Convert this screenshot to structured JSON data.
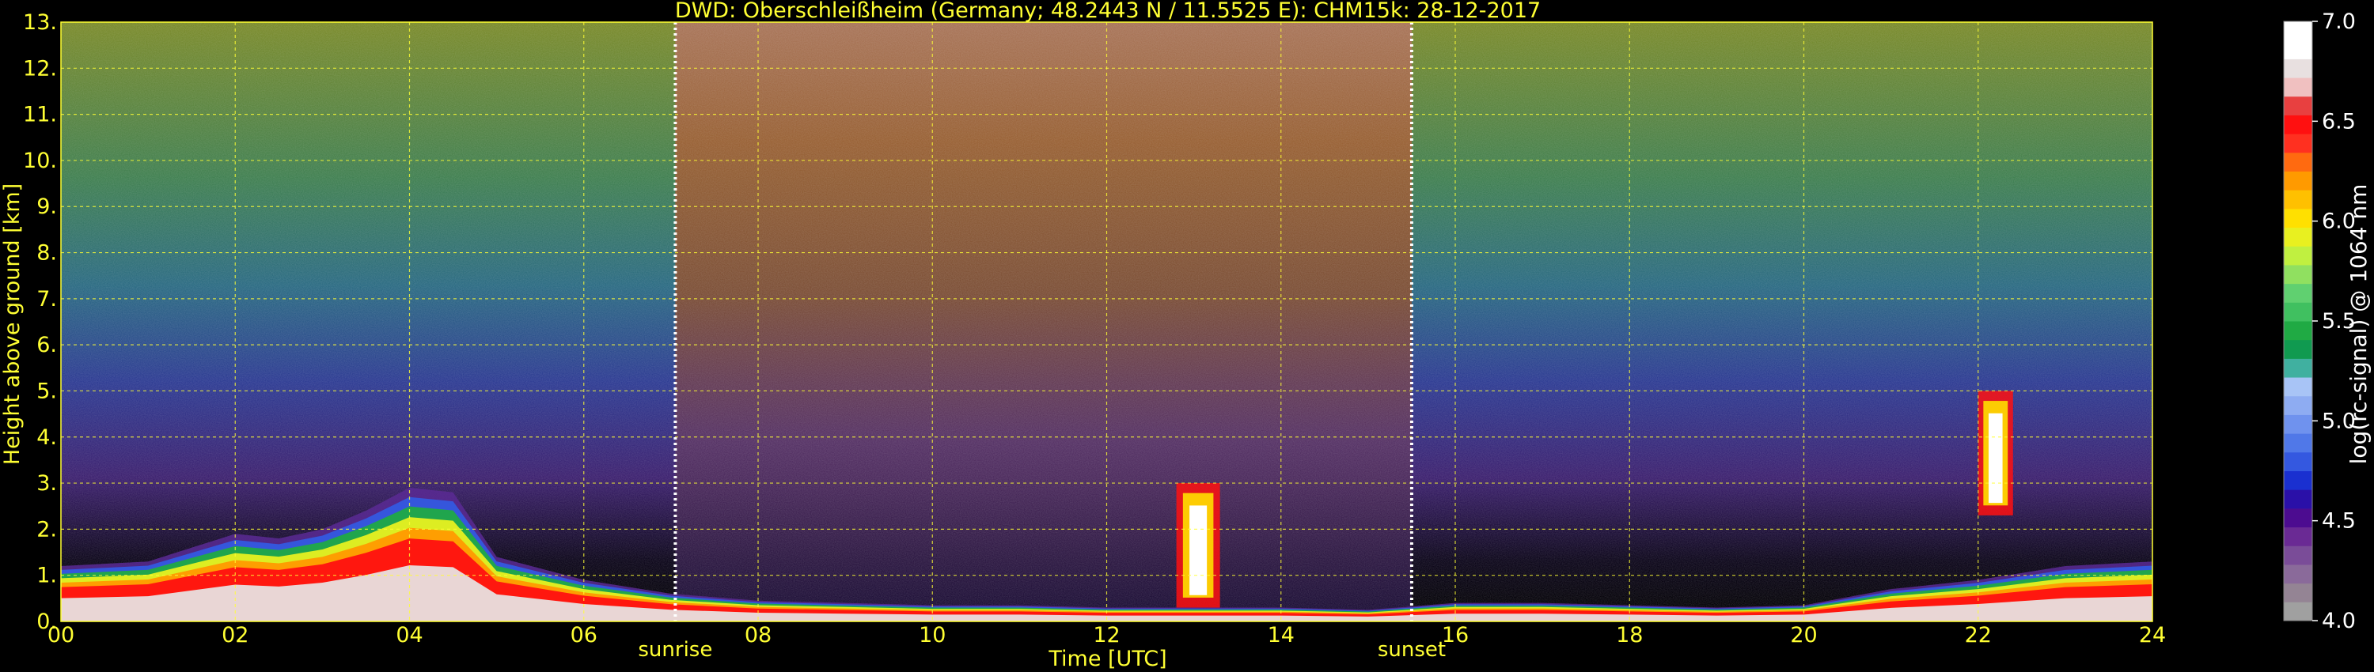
{
  "chart_data": {
    "type": "heatmap",
    "title": "DWD: Oberschleißheim (Germany; 48.2443 N / 11.5525 E):    CHM15k: 28-12-2017",
    "xlabel": "Time [UTC]",
    "ylabel": "Height above ground [km]",
    "xlim": [
      0,
      24
    ],
    "ylim": [
      0,
      13
    ],
    "x_ticks": [
      "00",
      "02",
      "04",
      "06",
      "08",
      "10",
      "12",
      "14",
      "16",
      "18",
      "20",
      "22",
      "24"
    ],
    "y_ticks": [
      "0.",
      "1.",
      "2.",
      "3.",
      "4.",
      "5.",
      "6.",
      "7.",
      "8.",
      "9.",
      "10.",
      "11.",
      "12.",
      "13."
    ],
    "grid": true,
    "markers": [
      {
        "label": "sunrise",
        "time": 7.05
      },
      {
        "label": "sunset",
        "time": 15.5
      }
    ],
    "colorbar": {
      "label": "log(rc-signal) @ 1064 nm",
      "range": [
        4.0,
        7.0
      ],
      "ticks": [
        "4.0",
        "4.5",
        "5.0",
        "5.5",
        "6.0",
        "6.5",
        "7.0"
      ],
      "colors": [
        "#a0a0a0",
        "#948494",
        "#8a6a9a",
        "#7a4c98",
        "#6a2a94",
        "#4c0c90",
        "#2a10a8",
        "#1a30d0",
        "#3458e0",
        "#5078e8",
        "#6f92ee",
        "#8eacf2",
        "#a8c4f6",
        "#40b0a0",
        "#109a50",
        "#20aa44",
        "#40c060",
        "#60d070",
        "#90e060",
        "#c0f040",
        "#e8f020",
        "#ffe000",
        "#ffc000",
        "#ff9a00",
        "#ff6a10",
        "#ff3020",
        "#ff1010",
        "#e84040",
        "#f0c0c0",
        "#e8e0e0",
        "#ffffff",
        "#ffffff"
      ]
    },
    "features": [
      {
        "type": "boundary_layer_aerosol",
        "x": [
          0,
          1,
          2,
          2.5,
          3,
          3.5,
          4,
          4.5,
          5,
          6,
          7,
          8,
          9,
          10,
          11,
          12,
          13,
          14,
          15,
          16,
          17,
          18,
          19,
          20,
          21,
          22,
          23,
          24
        ],
        "top_km": [
          1.2,
          1.3,
          1.9,
          1.8,
          2.0,
          2.4,
          2.9,
          2.8,
          1.4,
          0.9,
          0.6,
          0.45,
          0.4,
          0.35,
          0.35,
          0.3,
          0.3,
          0.3,
          0.25,
          0.4,
          0.4,
          0.35,
          0.3,
          0.35,
          0.7,
          0.9,
          1.2,
          1.3
        ]
      },
      {
        "type": "cloud",
        "time": [
          12.8,
          13.3
        ],
        "height_km": [
          0.3,
          3.0
        ]
      },
      {
        "type": "cloud",
        "time": [
          22.0,
          22.4
        ],
        "height_km": [
          2.3,
          5.0
        ]
      }
    ]
  }
}
